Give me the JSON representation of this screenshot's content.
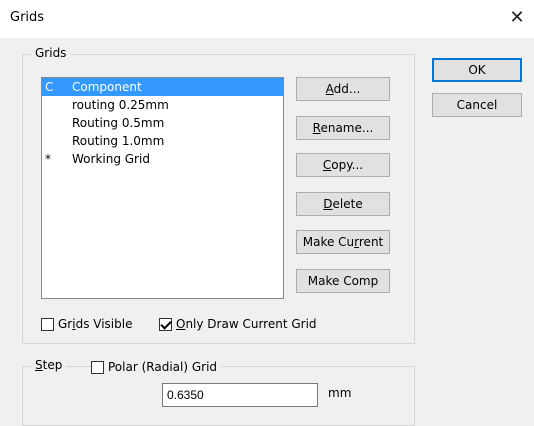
{
  "window": {
    "title": "Grids",
    "close_glyph": "✕"
  },
  "grids_group": {
    "legend": "Grids",
    "list": [
      {
        "mark": "C",
        "name": "Component",
        "selected": true
      },
      {
        "mark": "",
        "name": "routing 0.25mm",
        "selected": false
      },
      {
        "mark": "",
        "name": "Routing 0.5mm",
        "selected": false
      },
      {
        "mark": "",
        "name": "Routing 1.0mm",
        "selected": false
      },
      {
        "mark": "*",
        "name": "Working Grid",
        "selected": false
      }
    ],
    "buttons": {
      "add": {
        "pre": "",
        "u": "A",
        "post": "dd..."
      },
      "rename": {
        "pre": "",
        "u": "R",
        "post": "ename..."
      },
      "copy": {
        "pre": "",
        "u": "C",
        "post": "opy..."
      },
      "delete": {
        "pre": "",
        "u": "D",
        "post": "elete"
      },
      "make_current": {
        "pre": "Make Cu",
        "u": "r",
        "post": "rent"
      },
      "make_comp": {
        "pre": "Make Comp",
        "u": "",
        "post": ""
      }
    },
    "grids_visible": {
      "pre": "Gr",
      "u": "i",
      "post": "ds Visible",
      "checked": false
    },
    "only_draw_current": {
      "pre": "",
      "u": "O",
      "post": "nly Draw Current Grid",
      "checked": true
    }
  },
  "dialog_buttons": {
    "ok": "OK",
    "cancel": "Cancel"
  },
  "step_group": {
    "legend_pre": "",
    "legend_u": "S",
    "legend_post": "tep",
    "polar": {
      "label": "Polar (Radial) Grid",
      "checked": false
    },
    "step_value": "0.6350",
    "unit": "mm"
  }
}
